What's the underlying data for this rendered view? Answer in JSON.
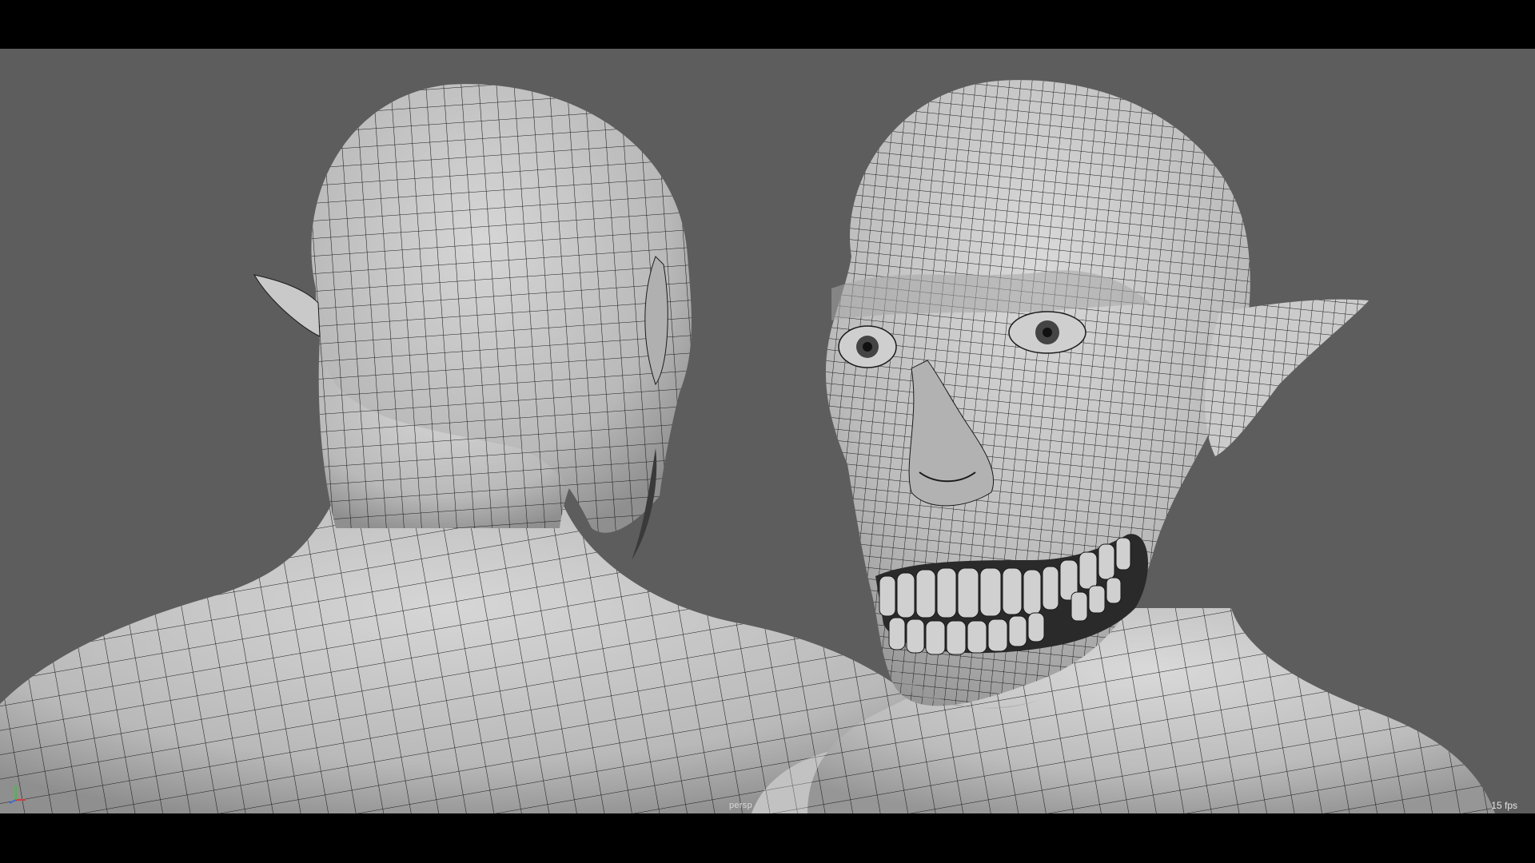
{
  "viewport": {
    "camera_name": "persp",
    "frame_rate_readout": "15 fps",
    "background_color": "#5d5d5d",
    "letterbox_color": "#000000",
    "shading_mode": "smooth-shaded-with-wireframe",
    "wire_color": "#1a1a1a",
    "surface_color": "#c4c4c4"
  },
  "scene": {
    "models": [
      {
        "view": "back-three-quarter",
        "subject": "bald-head-neck-shoulders"
      },
      {
        "view": "front-three-quarter",
        "subject": "goblin-head-with-pointed-ears-and-exposed-teeth"
      }
    ]
  },
  "icons": {
    "axis_gizmo": "xyz-axis-gizmo-icon"
  },
  "axis_colors": {
    "x": "#d23c3c",
    "y": "#3cc23c",
    "z": "#3c6cd2"
  }
}
